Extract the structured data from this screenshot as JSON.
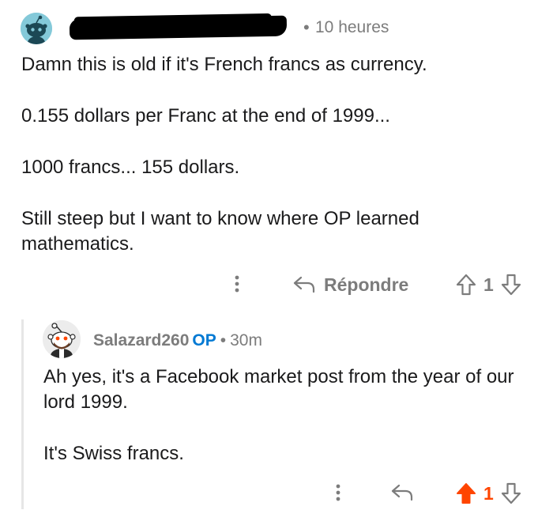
{
  "colors": {
    "text": "#1a1a1b",
    "meta": "#7c7c7c",
    "op_badge": "#0079d3",
    "upvoted": "#ff4500",
    "avatar_main_bg": "#84c9d9",
    "thread_line": "#e6e6e6"
  },
  "comment": {
    "author_redacted": true,
    "separator": "•",
    "time": "10 heures",
    "body": [
      "Damn this is old if it's French francs as currency.",
      "0.155 dollars per Franc at the end of 1999...",
      "1000 francs... 155 dollars.",
      "Still steep but I want to know where OP learned mathematics."
    ],
    "actions": {
      "more_icon": "more-vertical-icon",
      "reply_icon": "reply-arrow-icon",
      "reply_label": "Répondre",
      "upvote_icon": "upvote-arrow-icon",
      "score": "1",
      "downvote_icon": "downvote-arrow-icon"
    }
  },
  "reply": {
    "author": "Salazard260",
    "op_label": "OP",
    "separator": "•",
    "time": "30m",
    "body": [
      "Ah yes, it's a Facebook market post from the year of our lord 1999.",
      "It's Swiss francs."
    ],
    "actions": {
      "more_icon": "more-vertical-icon",
      "reply_icon": "reply-arrow-icon",
      "upvote_icon": "upvote-arrow-filled-icon",
      "upvoted": true,
      "score": "1",
      "downvote_icon": "downvote-arrow-icon"
    }
  }
}
